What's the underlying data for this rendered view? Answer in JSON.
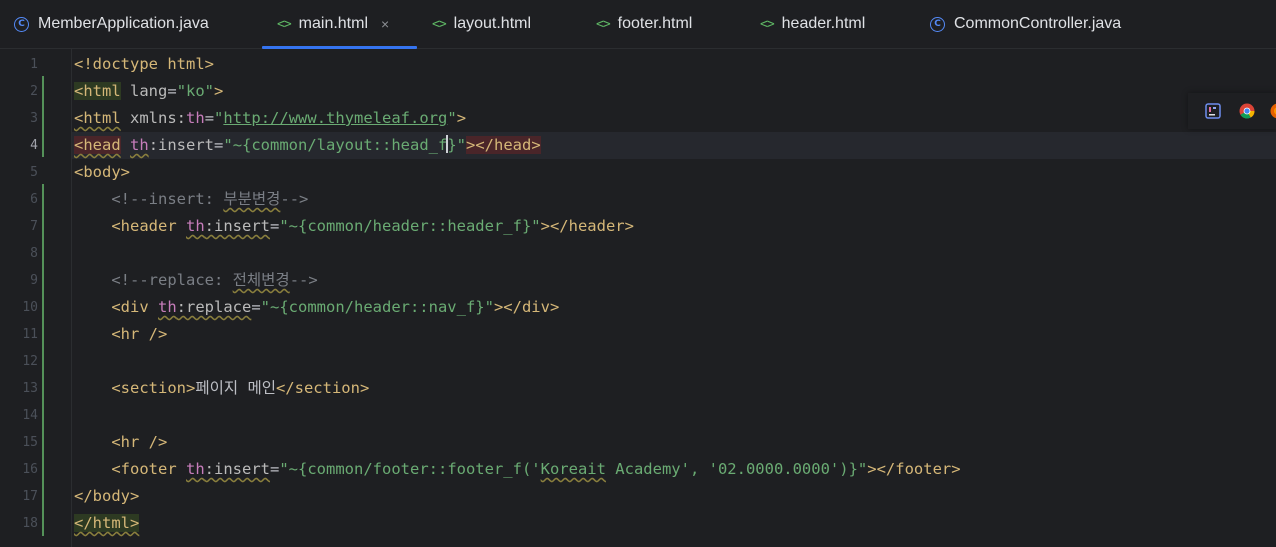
{
  "tabs": [
    {
      "label": "MemberApplication.java",
      "icon": "java-class-icon",
      "active": false
    },
    {
      "label": "main.html",
      "icon": "html-file-icon",
      "active": true
    },
    {
      "label": "layout.html",
      "icon": "html-file-icon",
      "active": false
    },
    {
      "label": "footer.html",
      "icon": "html-file-icon",
      "active": false
    },
    {
      "label": "header.html",
      "icon": "html-file-icon",
      "active": false
    },
    {
      "label": "CommonController.java",
      "icon": "java-class-icon",
      "active": false
    }
  ],
  "glyphs": {
    "java_class": "C",
    "html_file": "<>",
    "close": "×"
  },
  "line_numbers": [
    "1",
    "2",
    "3",
    "4",
    "5",
    "6",
    "7",
    "8",
    "9",
    "10",
    "11",
    "12",
    "13",
    "14",
    "15",
    "16",
    "17",
    "18"
  ],
  "current_line": 4,
  "code": {
    "l1": {
      "doctype": "<!doctype html>"
    },
    "l2": {
      "open": "<html",
      "attr": " lang",
      "eq": "=",
      "val": "\"ko\"",
      "close": ">"
    },
    "l3": {
      "open": "<html",
      "sp": " ",
      "attr": "xmlns:",
      "ns": "th",
      "eq": "=",
      "q1": "\"",
      "url": "http://www.thymeleaf.org",
      "q2": "\"",
      "close": ">"
    },
    "l4": {
      "open": "<head",
      "sp": " ",
      "ns": "th",
      "attr": ":insert",
      "eq": "=",
      "val_a": "\"~{common/layout::head_f",
      "val_b": "}\"",
      "close_open": ">",
      "end_tag": "</head>"
    },
    "l5": {
      "tag": "<body>"
    },
    "l6": {
      "indent": "    ",
      "pre": "<!--insert: ",
      "kor": "부분변경",
      "post": "-->"
    },
    "l7": {
      "indent": "    ",
      "open": "<header",
      "sp": " ",
      "ns": "th",
      "attr": ":insert",
      "eq": "=",
      "val": "\"~{common/header::header_f}\"",
      "close": "></header>"
    },
    "l8": {
      "text": ""
    },
    "l9": {
      "indent": "    ",
      "pre": "<!--replace: ",
      "kor": "전체변경",
      "post": "-->"
    },
    "l10": {
      "indent": "    ",
      "open": "<div",
      "sp": " ",
      "ns": "th",
      "attr": ":replace",
      "eq": "=",
      "val": "\"~{common/header::nav_f}\"",
      "close": "></div>"
    },
    "l11": {
      "indent": "    ",
      "tag": "<hr />"
    },
    "l12": {
      "text": ""
    },
    "l13": {
      "indent": "    ",
      "open": "<section>",
      "body": "페이지 메인",
      "close": "</section>"
    },
    "l14": {
      "text": ""
    },
    "l15": {
      "indent": "    ",
      "tag": "<hr />"
    },
    "l16": {
      "indent": "    ",
      "open": "<footer",
      "sp": " ",
      "ns": "th",
      "attr": ":insert",
      "eq": "=",
      "val_a": "\"~{common/footer::footer_f('",
      "val_word": "Koreait",
      "val_b": " Academy', '02.0000.0000')}\"",
      "close": "></footer>"
    },
    "l17": {
      "tag": "</body>"
    },
    "l18": {
      "tag": "</html>"
    }
  },
  "colors": {
    "background": "#1e1f22",
    "tag": "#d5b778",
    "string": "#6aab73",
    "namespace": "#c77dbb",
    "comment": "#7a7e85",
    "accent": "#3574f0"
  },
  "browser_icons": [
    "intellij-icon",
    "chrome-icon",
    "firefox-icon"
  ]
}
